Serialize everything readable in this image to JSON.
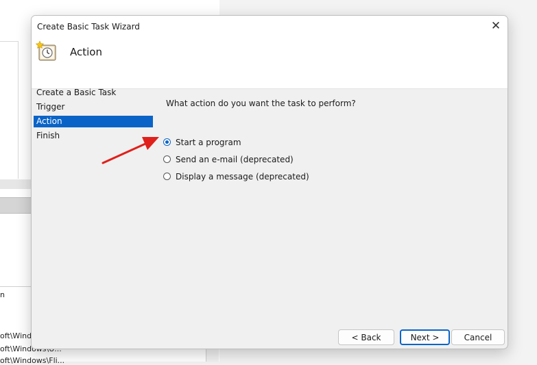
{
  "background": {
    "path_lines": [
      "n",
      "oft\\Wind",
      "oft\\Windows\\U...",
      "oft\\Windows\\Fli..."
    ]
  },
  "dialog": {
    "title": "Create Basic Task Wizard",
    "close_symbol": "✕",
    "header_title": "Action",
    "header_icon": "clock-icon",
    "steps": [
      {
        "label": "Create a Basic Task",
        "active": false
      },
      {
        "label": "Trigger",
        "active": false
      },
      {
        "label": "Action",
        "active": true
      },
      {
        "label": "Finish",
        "active": false
      }
    ],
    "question": "What action do you want the task to perform?",
    "options": [
      {
        "label": "Start a program",
        "checked": true
      },
      {
        "label": "Send an e-mail (deprecated)",
        "checked": false
      },
      {
        "label": "Display a message (deprecated)",
        "checked": false
      }
    ],
    "buttons": {
      "back": "< Back",
      "next": "Next >",
      "cancel": "Cancel"
    }
  },
  "colors": {
    "accent": "#0a64c8",
    "annotation_arrow": "#e0201b"
  }
}
